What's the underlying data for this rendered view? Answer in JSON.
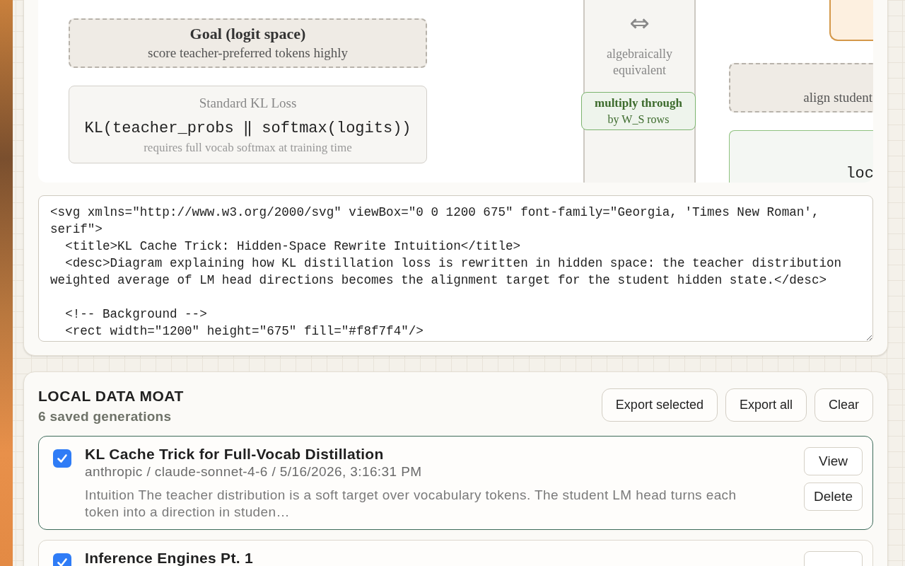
{
  "diagram_preview": {
    "nodes": [
      {
        "kind": "goal",
        "title": "Goal (logit space)",
        "text": "score teacher-preferred tokens highly"
      },
      {
        "kind": "loss",
        "title": "Standard KL Loss",
        "formula": "KL(teacher_probs ‖ softmax(logits))",
        "note": "requires full vocab softmax at training time"
      },
      {
        "kind": "bridge",
        "symbol": "⇔",
        "text": "algebraically equivalent",
        "badge": {
          "title": "multiply through",
          "text": "by W_S rows"
        }
      },
      {
        "kind": "accent"
      },
      {
        "kind": "goal_cut",
        "text": "align student"
      },
      {
        "kind": "formula_cut",
        "formula": "loc"
      }
    ]
  },
  "svg_source": {
    "value": "<svg xmlns=\"http://www.w3.org/2000/svg\" viewBox=\"0 0 1200 675\" font-family=\"Georgia, 'Times New Roman', serif\">\n  <title>KL Cache Trick: Hidden-Space Rewrite Intuition</title>\n  <desc>Diagram explaining how KL distillation loss is rewritten in hidden space: the teacher distribution weighted average of LM head directions becomes the alignment target for the student hidden state.</desc>\n\n  <!-- Background -->\n  <rect width=\"1200\" height=\"675\" fill=\"#f8f7f4\"/>"
  },
  "data_moat": {
    "title": "LOCAL DATA MOAT",
    "subtitle": "6 saved generations",
    "actions": [
      "Export selected",
      "Export all",
      "Clear"
    ],
    "generations": [
      {
        "title": "KL Cache Trick for Full-Vocab Distillation",
        "meta": "anthropic / claude-sonnet-4-6 / 5/16/2026, 3:16:31 PM",
        "snippet": "Intuition The teacher distribution is a soft target over vocabulary tokens. The student LM head turns each token into a direction in studen…",
        "checked": true,
        "selected": true,
        "actions": [
          {
            "kind": "button",
            "label": "View"
          },
          {
            "kind": "button",
            "label": "Delete"
          }
        ]
      },
      {
        "title": "Inference Engines Pt. 1",
        "checked": true,
        "selected": false,
        "actions": [
          {
            "kind": "button"
          }
        ]
      }
    ]
  }
}
